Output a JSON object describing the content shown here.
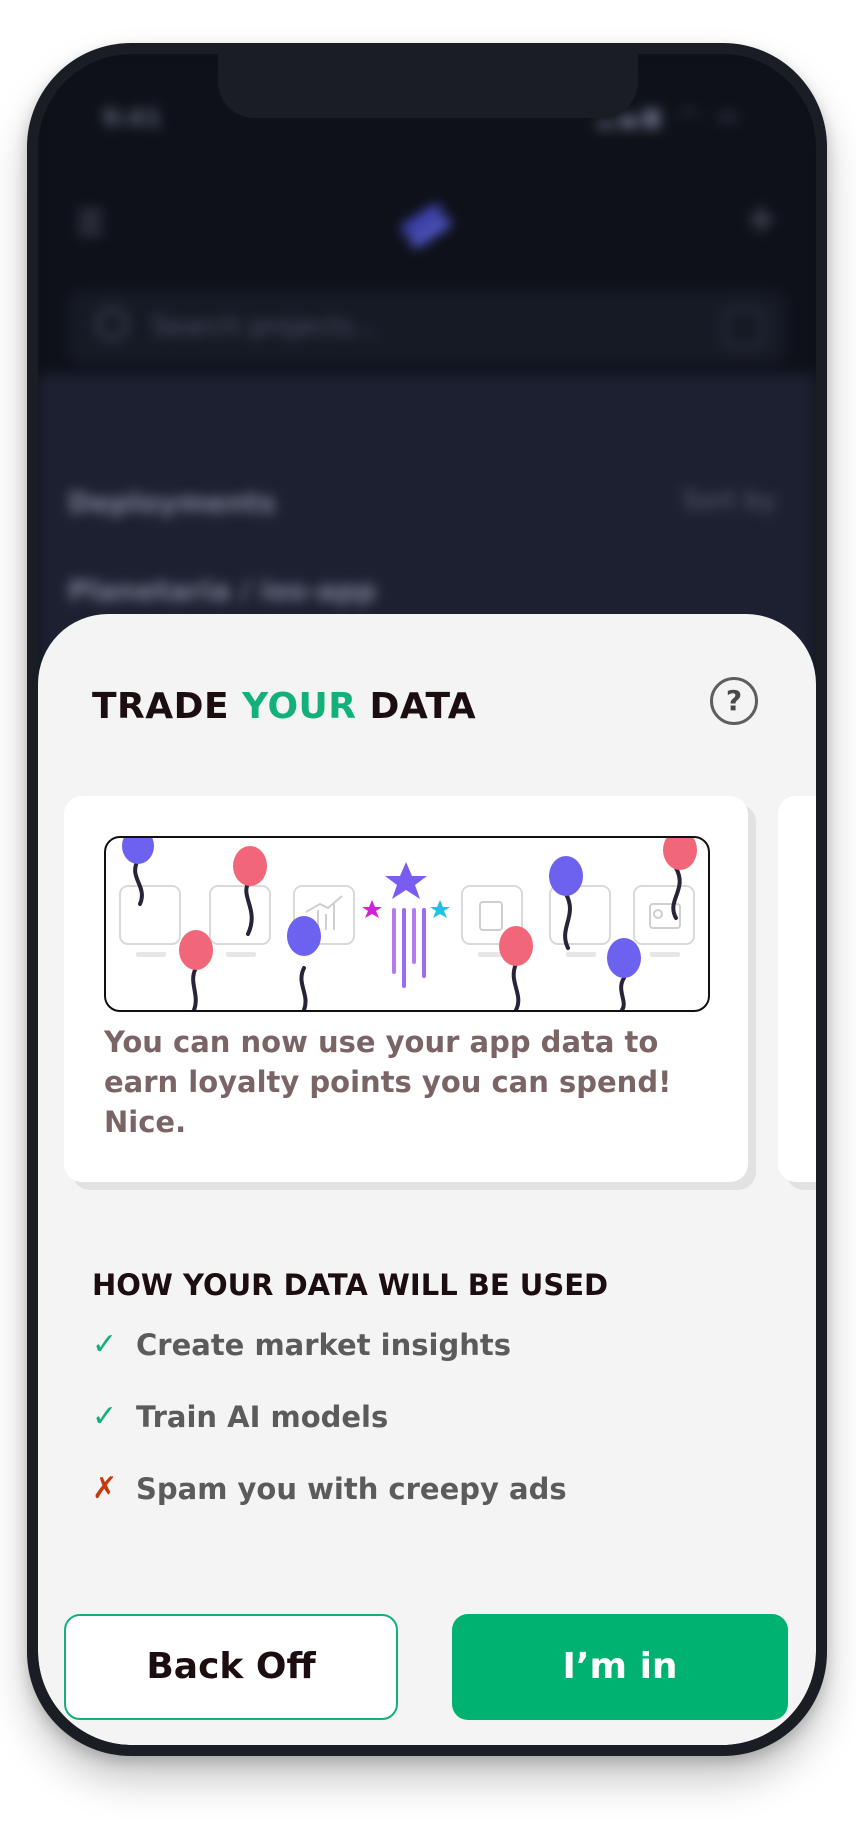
{
  "background_app": {
    "status_time": "9:41",
    "status_icons": "▂▄▆ ◠ ▭",
    "search_placeholder": "Search projects...",
    "section_title": "Deployments",
    "sort_label": "Sort by",
    "breadcrumb": "Planetaria  /  ios-app"
  },
  "sheet": {
    "title_prefix": "TRADE ",
    "title_accent": "YOUR",
    "title_suffix": " DATA",
    "help_label": "?",
    "card_text": "You can now use your app data to earn loyalty points you can spend! Nice.",
    "usage_heading": "HOW YOUR DATA WILL BE USED",
    "usage_items": [
      {
        "label": "Create market insights",
        "allowed": true,
        "mark": "✓"
      },
      {
        "label": "Train AI models",
        "allowed": true,
        "mark": "✓"
      },
      {
        "label": "Spam you with creepy ads",
        "allowed": false,
        "mark": "✗"
      }
    ],
    "back_button": "Back Off",
    "accept_button": "I’m in"
  },
  "colors": {
    "accent_green": "#00b271",
    "title_green": "#14b07a",
    "deny_red": "#c43a10",
    "balloon_pink": "#f2667a",
    "balloon_purple": "#6d62f0",
    "star_purple": "#7a5cf0",
    "star_magenta": "#d81fd8",
    "star_cyan": "#1ec3e0"
  }
}
